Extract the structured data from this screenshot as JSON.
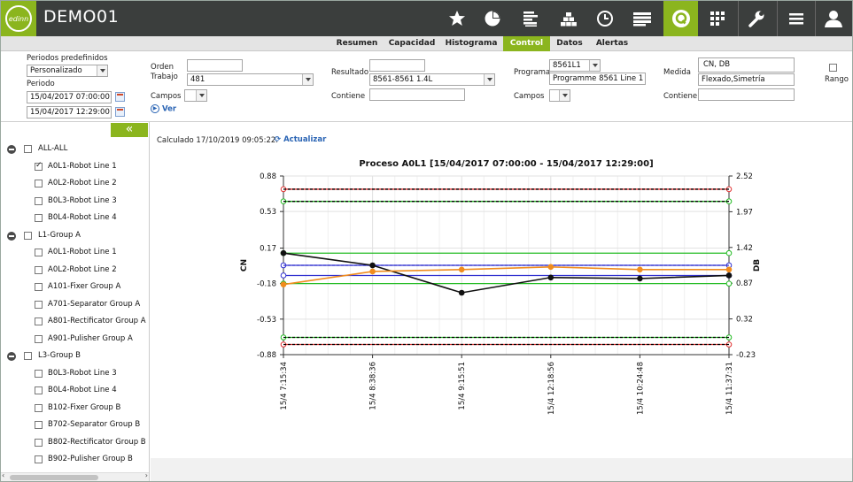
{
  "app": {
    "title": "DEMO01",
    "logo_text": "edinn"
  },
  "topnav": {
    "icons": [
      "star-icon",
      "pie-chart-icon",
      "list-bars-icon",
      "pyramid-icon",
      "clock-icon",
      "stack-icon",
      "quality-q-icon",
      "grid-icon",
      "wrench-icon",
      "menu-icon",
      "user-icon"
    ],
    "active": "quality-q-icon",
    "accent": "#8bb51e"
  },
  "tabs": [
    {
      "label": "Resumen",
      "active": false
    },
    {
      "label": "Capacidad",
      "active": false
    },
    {
      "label": "Histograma",
      "active": false
    },
    {
      "label": "Control",
      "active": true
    },
    {
      "label": "Datos",
      "active": false
    },
    {
      "label": "Alertas",
      "active": false
    }
  ],
  "filters": {
    "predef_label": "Periodos predefinidos",
    "predef_value": "Personalizado",
    "periodo_label": "Periodo",
    "date_from": "15/04/2017 07:00:00",
    "date_to": "15/04/2017 12:29:00",
    "orden_label": "Orden",
    "orden_value": "",
    "trabajo_label": "Trabajo",
    "trabajo_value": "481",
    "campos_label": "Campos",
    "ver_label": "Ver",
    "resultado_label": "Resultado",
    "resultado_value": "",
    "resultado_select": "8561-8561 1.4L",
    "contiene_label": "Contiene",
    "contiene_value": "",
    "programa_label": "Programa",
    "programa_code": "8561L1",
    "programa_name": "Programme 8561 Line 1",
    "campos2_label": "Campos",
    "medida_label": "Medida",
    "medida_value": "CN, DB",
    "medida_desc": "Flexado,Simetría",
    "contiene2_label": "Contiene",
    "contiene2_value": "",
    "rango_label": "Rango"
  },
  "tree": [
    {
      "label": "ALL-ALL",
      "level": 0,
      "group": true,
      "checked": false
    },
    {
      "label": "A0L1-Robot Line 1",
      "level": 1,
      "group": false,
      "checked": true
    },
    {
      "label": "A0L2-Robot Line 2",
      "level": 1,
      "group": false,
      "checked": false
    },
    {
      "label": "B0L3-Robot Line 3",
      "level": 1,
      "group": false,
      "checked": false
    },
    {
      "label": "B0L4-Robot Line 4",
      "level": 1,
      "group": false,
      "checked": false
    },
    {
      "label": "L1-Group A",
      "level": 0,
      "group": true,
      "checked": false
    },
    {
      "label": "A0L1-Robot Line 1",
      "level": 1,
      "group": false,
      "checked": false
    },
    {
      "label": "A0L2-Robot Line 2",
      "level": 1,
      "group": false,
      "checked": false
    },
    {
      "label": "A101-Fixer Group A",
      "level": 1,
      "group": false,
      "checked": false
    },
    {
      "label": "A701-Separator Group A",
      "level": 1,
      "group": false,
      "checked": false
    },
    {
      "label": "A801-Rectificator Group A",
      "level": 1,
      "group": false,
      "checked": false
    },
    {
      "label": "A901-Pulisher Group A",
      "level": 1,
      "group": false,
      "checked": false
    },
    {
      "label": "L3-Group B",
      "level": 0,
      "group": true,
      "checked": false
    },
    {
      "label": "B0L3-Robot Line 3",
      "level": 1,
      "group": false,
      "checked": false
    },
    {
      "label": "B0L4-Robot Line 4",
      "level": 1,
      "group": false,
      "checked": false
    },
    {
      "label": "B102-Fixer Group B",
      "level": 1,
      "group": false,
      "checked": false
    },
    {
      "label": "B702-Separator Group B",
      "level": 1,
      "group": false,
      "checked": false
    },
    {
      "label": "B802-Rectificator Group B",
      "level": 1,
      "group": false,
      "checked": false
    },
    {
      "label": "B902-Pulisher Group B",
      "level": 1,
      "group": false,
      "checked": false
    }
  ],
  "status": {
    "calculated": "Calculado 17/10/2019 09:05:22.",
    "refresh_label": "Actualizar"
  },
  "chart_data": {
    "type": "line",
    "title": "Proceso A0L1 [15/04/2017 07:00:00 - 15/04/2017 12:29:00]",
    "categories": [
      "15/4 7:15:34",
      "15/4 8:38:36",
      "15/4 9:15:51",
      "15/4 12:18:56",
      "15/4 10:24:48",
      "15/4 11:37:31"
    ],
    "ylabel_left": "CN",
    "ylabel_right": "DB",
    "ylim_left": [
      -0.88,
      0.88
    ],
    "ylim_right": [
      -0.23,
      2.52
    ],
    "yticks_left": [
      "0.88",
      "0.53",
      "0.17",
      "-0.18",
      "-0.53",
      "-0.88"
    ],
    "yticks_right": [
      "2.52",
      "1.97",
      "1.42",
      "0.87",
      "0.32",
      "-0.23"
    ],
    "grid": true,
    "series": [
      {
        "axis": "left",
        "color": "#111111",
        "values": [
          0.12,
          0.0,
          -0.27,
          -0.12,
          -0.13,
          -0.1
        ]
      },
      {
        "axis": "right",
        "color": "#f08c1e",
        "values": [
          0.85,
          1.05,
          1.08,
          1.12,
          1.08,
          1.08
        ]
      }
    ],
    "ref_lines": [
      {
        "axis": "left",
        "value": 0.75,
        "color": "#e03030",
        "dashed": false
      },
      {
        "axis": "left",
        "value": 0.75,
        "color": "#000000",
        "dashed": true
      },
      {
        "axis": "left",
        "value": 0.63,
        "color": "#22bb22",
        "dashed": false
      },
      {
        "axis": "left",
        "value": 0.63,
        "color": "#000000",
        "dashed": true
      },
      {
        "axis": "left",
        "value": 0.12,
        "color": "#22bb22",
        "dashed": false
      },
      {
        "axis": "left",
        "value": 0.0,
        "color": "#3030d0",
        "dashed": false
      },
      {
        "axis": "left",
        "value": 0.0,
        "color": "#3030d0",
        "dashed": true
      },
      {
        "axis": "left",
        "value": -0.1,
        "color": "#3030d0",
        "dashed": false
      },
      {
        "axis": "left",
        "value": -0.18,
        "color": "#22bb22",
        "dashed": false
      },
      {
        "axis": "left",
        "value": -0.71,
        "color": "#22bb22",
        "dashed": false
      },
      {
        "axis": "left",
        "value": -0.71,
        "color": "#000000",
        "dashed": true
      },
      {
        "axis": "left",
        "value": -0.78,
        "color": "#e03030",
        "dashed": false
      },
      {
        "axis": "left",
        "value": -0.78,
        "color": "#000000",
        "dashed": true
      }
    ]
  }
}
